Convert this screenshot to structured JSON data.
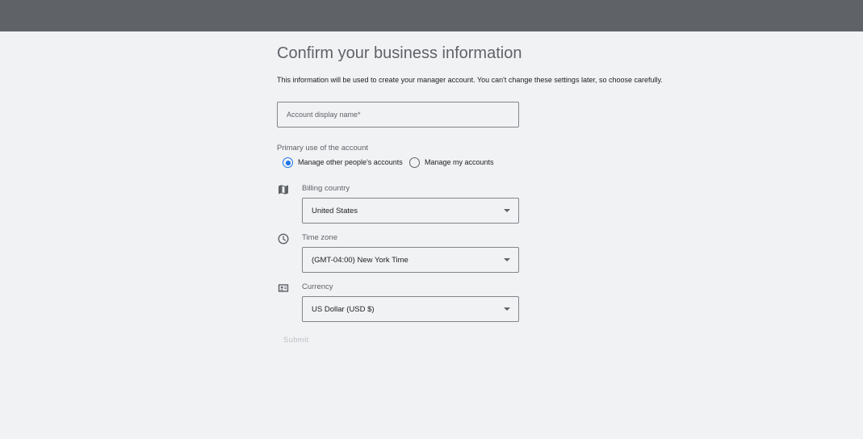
{
  "page": {
    "title": "Confirm your business information",
    "description": "This information will be used to create your manager account. You can't change these settings later, so choose carefully."
  },
  "account_name": {
    "placeholder": "Account display name*",
    "value": ""
  },
  "primary_use": {
    "label": "Primary use of the account",
    "options": [
      {
        "label": "Manage other people's accounts",
        "checked": true
      },
      {
        "label": "Manage my accounts",
        "checked": false
      }
    ]
  },
  "billing_country": {
    "label": "Billing country",
    "value": "United States",
    "icon": "map-icon"
  },
  "time_zone": {
    "label": "Time zone",
    "value": "(GMT-04:00) New York Time",
    "icon": "clock-icon"
  },
  "currency": {
    "label": "Currency",
    "value": "US Dollar (USD $)",
    "icon": "currency-card-icon"
  },
  "submit": {
    "label": "Submit",
    "enabled": false
  },
  "colors": {
    "accent": "#1a73e8",
    "topbar": "#5f6368",
    "background": "#f1f2f4",
    "disabled_text": "#bdc1c6"
  }
}
